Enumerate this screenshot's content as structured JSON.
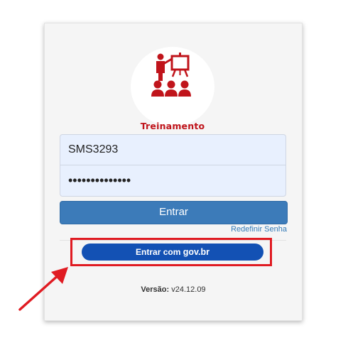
{
  "logo": {
    "text": "Treinamento",
    "color": "#c0141b"
  },
  "login": {
    "username_value": "SMS3293",
    "password_value": "••••••••••••••",
    "submit_label": "Entrar",
    "reset_link": "Redefinir Senha"
  },
  "govbr": {
    "prefix": "Entrar com ",
    "brand": "gov.br",
    "color": "#1351b4"
  },
  "version": {
    "label": "Versão:",
    "value": "v24.12.09"
  },
  "annotation": {
    "highlight_color": "#e01b22",
    "icon": "red-arrow-icon"
  }
}
